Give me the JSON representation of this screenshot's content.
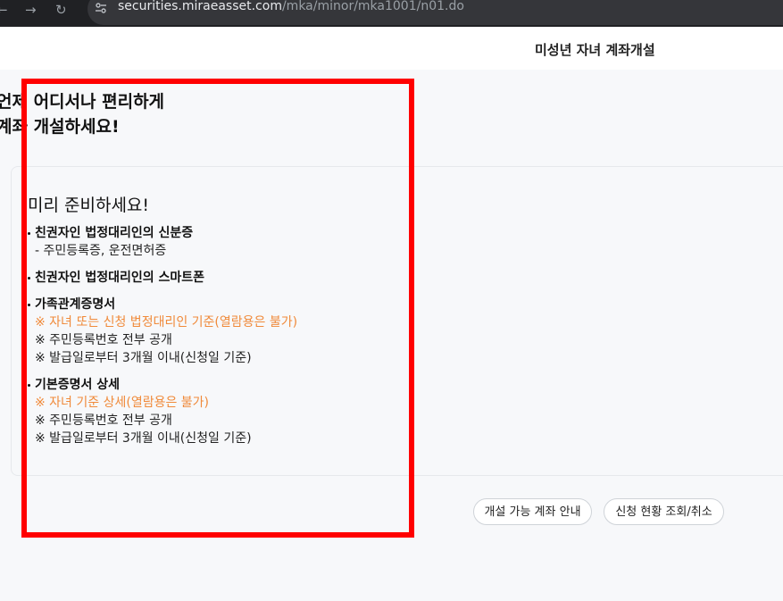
{
  "browser": {
    "back_icon": "arrow-left-icon",
    "forward_icon": "arrow-right-icon",
    "reload_icon": "reload-icon",
    "site_info_icon": "tune-icon",
    "url_host": "securities.miraeasset.com",
    "url_path": "/mka/minor/mka1001/n01.do"
  },
  "header": {
    "title": "미성년 자녀 계좌개설"
  },
  "main": {
    "headline_line1": "언제 어디서나 편리하게",
    "headline_line2": "계좌 개설하세요!",
    "card_title": "미리 준비하세요!",
    "requirements": [
      {
        "title": "친권자인 법정대리인의 신분증",
        "lines": [
          {
            "text": "- 주민등록증, 운전면허증",
            "warn": false
          }
        ]
      },
      {
        "title": "친권자인 법정대리인의 스마트폰",
        "lines": []
      },
      {
        "title": "가족관계증명서",
        "lines": [
          {
            "text": "※ 자녀 또는 신청 법정대리인 기준(열람용은 불가)",
            "warn": true
          },
          {
            "text": "※ 주민등록번호 전부 공개",
            "warn": false
          },
          {
            "text": "※ 발급일로부터 3개월 이내(신청일 기준)",
            "warn": false
          }
        ]
      },
      {
        "title": "기본증명서 상세",
        "lines": [
          {
            "text": "※ 자녀 기준 상세(열람용은 불가)",
            "warn": true
          },
          {
            "text": "※ 주민등록번호 전부 공개",
            "warn": false
          },
          {
            "text": "※ 발급일로부터 3개월 이내(신청일 기준)",
            "warn": false
          }
        ]
      }
    ],
    "buttons": {
      "guide_label": "개설 가능 계좌 안내",
      "status_label": "신청 현황 조회/취소"
    }
  },
  "colors": {
    "warning_text": "#f08a3a",
    "highlight_border": "#ff0000",
    "page_background": "#f7f8fa"
  }
}
